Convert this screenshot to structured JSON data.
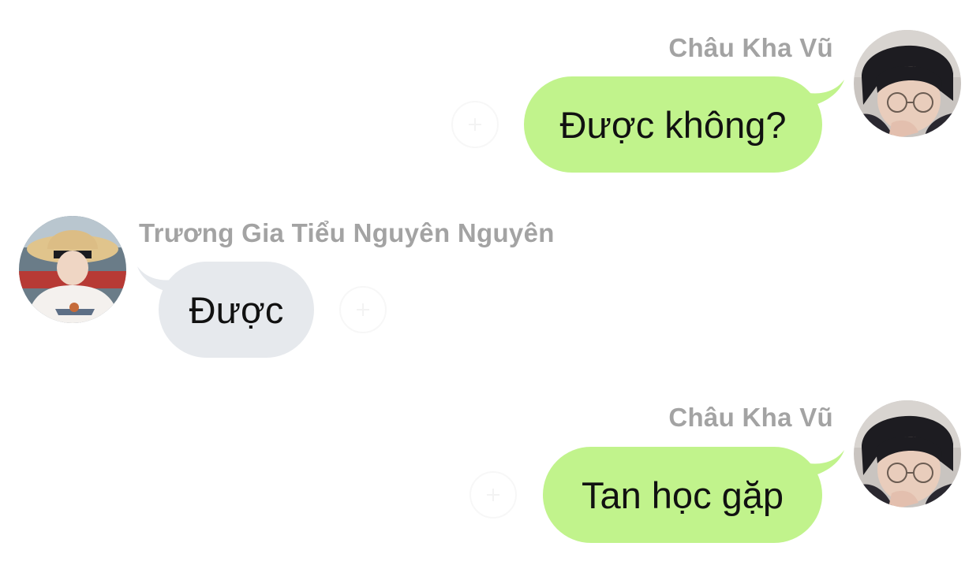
{
  "conversation": {
    "messages": [
      {
        "sender": "Châu Kha Vũ",
        "text": "Được không?",
        "side": "right"
      },
      {
        "sender": "Trương Gia Tiểu Nguyên Nguyên",
        "text": "Được",
        "side": "left"
      },
      {
        "sender": "Châu Kha Vũ",
        "text": "Tan học gặp",
        "side": "right"
      }
    ]
  },
  "colors": {
    "outgoing_bubble": "#c1f38c",
    "incoming_bubble": "#e6e9ed",
    "sender_name": "#a3a3a3",
    "message_text": "#111111"
  },
  "icons": {
    "avatar_right": "avatar-glasses-portrait",
    "avatar_left": "avatar-straw-hat-portrait",
    "reaction": "add-reaction-icon"
  }
}
